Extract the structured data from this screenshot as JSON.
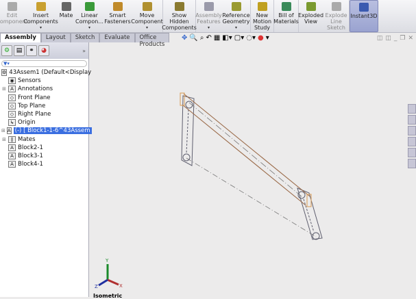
{
  "ribbon": [
    {
      "label": "Edit Component",
      "icon": "edit-component-icon",
      "disabled": true
    },
    {
      "label": "Insert Components",
      "icon": "insert-components-icon",
      "dropdown": true
    },
    {
      "label": "Mate",
      "icon": "mate-icon"
    },
    {
      "label": "Linear Compon...",
      "icon": "linear-pattern-icon",
      "dropdown": true
    },
    {
      "label": "Smart Fasteners",
      "icon": "smart-fasteners-icon"
    },
    {
      "label": "Move Component",
      "icon": "move-component-icon",
      "dropdown": true
    },
    {
      "label": "Show Hidden Components",
      "icon": "show-hidden-icon"
    },
    {
      "label": "Assembly Features",
      "icon": "assembly-features-icon",
      "disabled": true,
      "dropdown": true
    },
    {
      "label": "Reference Geometry",
      "icon": "reference-geometry-icon",
      "dropdown": true
    },
    {
      "label": "New Motion Study",
      "icon": "motion-study-icon"
    },
    {
      "label": "Bill of Materials",
      "icon": "bom-icon"
    },
    {
      "label": "Exploded View",
      "icon": "exploded-view-icon"
    },
    {
      "label": "Explode Line Sketch",
      "icon": "explode-line-icon",
      "disabled": true
    },
    {
      "label": "Instant3D",
      "icon": "instant3d-icon",
      "active": true
    }
  ],
  "tabs": [
    "Assembly",
    "Layout",
    "Sketch",
    "Evaluate",
    "Office Products"
  ],
  "tree": [
    {
      "label": "43Assem1  (Default<Display",
      "icon": "assembly-icon",
      "level": 0
    },
    {
      "label": "Sensors",
      "icon": "sensors-icon",
      "level": 1
    },
    {
      "label": "Annotations",
      "icon": "annotations-icon",
      "level": 1,
      "expand": true
    },
    {
      "label": "Front Plane",
      "icon": "plane-icon",
      "level": 1
    },
    {
      "label": "Top Plane",
      "icon": "plane-icon",
      "level": 1
    },
    {
      "label": "Right Plane",
      "icon": "plane-icon",
      "level": 1
    },
    {
      "label": "Origin",
      "icon": "origin-icon",
      "level": 1
    },
    {
      "label": "(-) [ Block1-1-6^43Assem",
      "icon": "block-icon",
      "level": 1,
      "expand": true,
      "selected": true
    },
    {
      "label": "Mates",
      "icon": "mates-icon",
      "level": 1,
      "expand": true
    },
    {
      "label": "Block2-1",
      "icon": "block-icon",
      "level": 1
    },
    {
      "label": "Block3-1",
      "icon": "block-icon",
      "level": 1
    },
    {
      "label": "Block4-1",
      "icon": "block-icon",
      "level": 1
    }
  ],
  "view_label": "Isometric",
  "triad": {
    "x": "X",
    "y": "Y",
    "z": "Z"
  },
  "colors": {
    "selection": "#3a6ee0",
    "link": "#6a6a78",
    "coupler": "#a86a3a"
  }
}
